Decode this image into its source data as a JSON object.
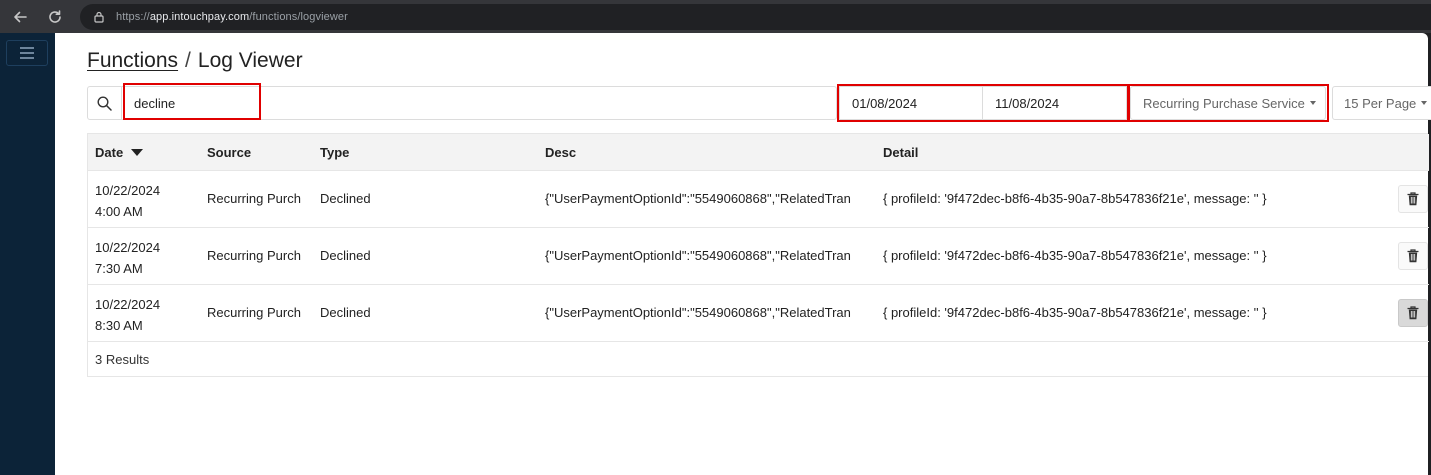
{
  "browser": {
    "url_scheme": "https://",
    "url_host": "app.intouchpay.com",
    "url_path": "/functions/logviewer"
  },
  "breadcrumb": {
    "parent": "Functions",
    "separator": "/",
    "current": "Log Viewer"
  },
  "filters": {
    "search_value": "decline",
    "start_date": "01/08/2024",
    "end_date": "11/08/2024",
    "service": "Recurring Purchase Service",
    "per_page": "15 Per Page"
  },
  "table": {
    "headers": {
      "date": "Date",
      "source": "Source",
      "type": "Type",
      "desc": "Desc",
      "detail": "Detail"
    },
    "rows": [
      {
        "date": "10/22/2024",
        "time": "4:00 AM",
        "source": "Recurring Purch",
        "type": "Declined",
        "desc": "{\"UserPaymentOptionId\":\"5549060868\",\"RelatedTran",
        "detail": "{ profileId: '9f472dec-b8f6-4b35-90a7-8b547836f21e', message: '' }"
      },
      {
        "date": "10/22/2024",
        "time": "7:30 AM",
        "source": "Recurring Purch",
        "type": "Declined",
        "desc": "{\"UserPaymentOptionId\":\"5549060868\",\"RelatedTran",
        "detail": "{ profileId: '9f472dec-b8f6-4b35-90a7-8b547836f21e', message: '' }"
      },
      {
        "date": "10/22/2024",
        "time": "8:30 AM",
        "source": "Recurring Purch",
        "type": "Declined",
        "desc": "{\"UserPaymentOptionId\":\"5549060868\",\"RelatedTran",
        "detail": "{ profileId: '9f472dec-b8f6-4b35-90a7-8b547836f21e', message: '' }"
      }
    ],
    "results_text": "3 Results"
  },
  "colors": {
    "sidebar": "#0c2338",
    "highlight": "#e00000"
  }
}
